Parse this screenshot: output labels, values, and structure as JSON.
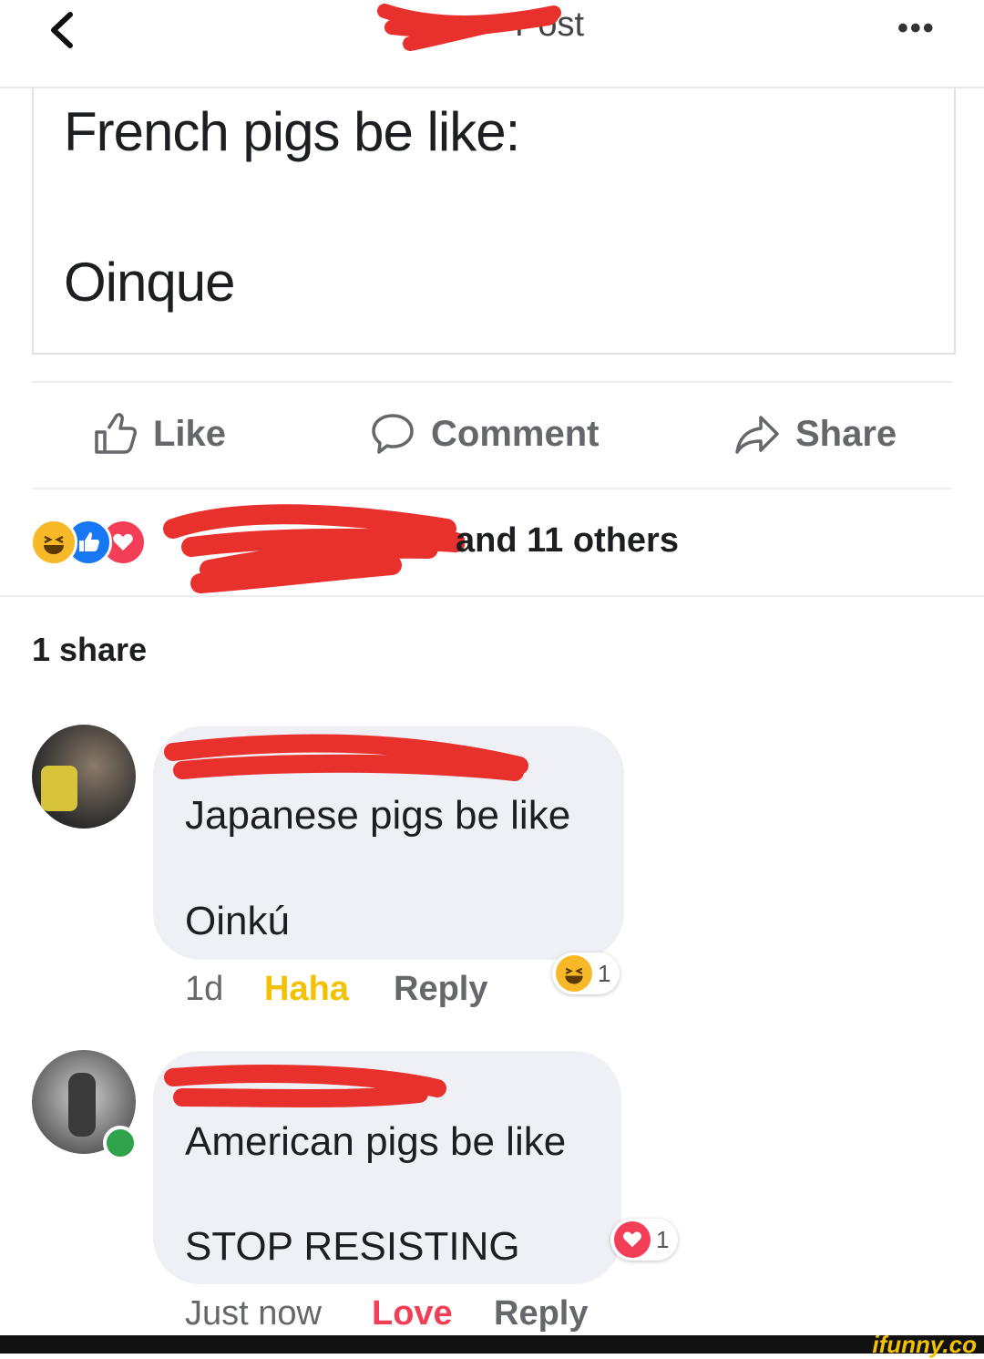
{
  "header": {
    "title": "Post",
    "more": "•••"
  },
  "post": {
    "line1": "French pigs be like:",
    "line2": "Oinque"
  },
  "actions": {
    "like": "Like",
    "comment": "Comment",
    "share": "Share"
  },
  "reactions_summary": {
    "others": "and 11 others"
  },
  "shares": "1 share",
  "comments": [
    {
      "line1": "Japanese pigs be like",
      "line2": "Oinkú",
      "time": "1d",
      "reaction_label": "Haha",
      "reply": "Reply",
      "badge_count": "1",
      "reaction_color": "#f7b928"
    },
    {
      "line1": "American pigs be like",
      "line2": "STOP RESISTING",
      "time": "Just now",
      "reaction_label": "Love",
      "reply": "Reply",
      "badge_count": "1",
      "reaction_color": "#f33e58"
    }
  ],
  "watermark": "ifunny.co",
  "colors": {
    "redaction": "#e8302c",
    "like_blue": "#1877f2",
    "love_red": "#f33e58",
    "haha_yellow": "#f7b928"
  }
}
